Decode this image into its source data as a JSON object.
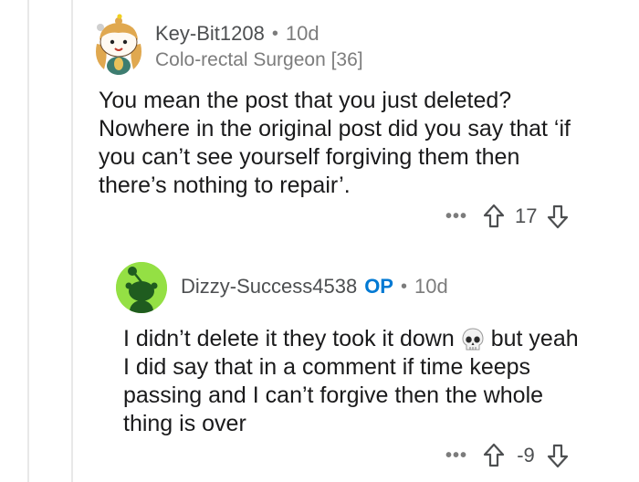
{
  "comments": [
    {
      "username": "Key-Bit1208",
      "age": "10d",
      "flair": "Colo-rectal Surgeon [36]",
      "body_lines": [
        "You mean the post that you just deleted?",
        "Nowhere in the original post did you say that ‘if",
        "you can’t see yourself forgiving them then",
        "there’s nothing to repair’."
      ],
      "more_label": "•••",
      "score": "17",
      "avatar_icon": "snoo-avatar-orange-hair-icon"
    },
    {
      "username": "Dizzy-Success4538",
      "op_badge": "OP",
      "age": "10d",
      "body_line1_before": "I didn’t delete it they took it down",
      "body_line1_after": "but yeah",
      "body_emoji": "skull-emoji",
      "body_lines": [
        "I did say that in a comment if time keeps",
        "passing and I can’t forgive then the whole",
        "thing is over"
      ],
      "more_label": "•••",
      "score": "-9",
      "avatar_icon": "default-green-snoo-avatar-icon"
    }
  ],
  "separator": "•",
  "colors": {
    "op_blue": "#0079d3",
    "avatar_green": "#94e044",
    "meta_gray": "#7c7c7c"
  }
}
